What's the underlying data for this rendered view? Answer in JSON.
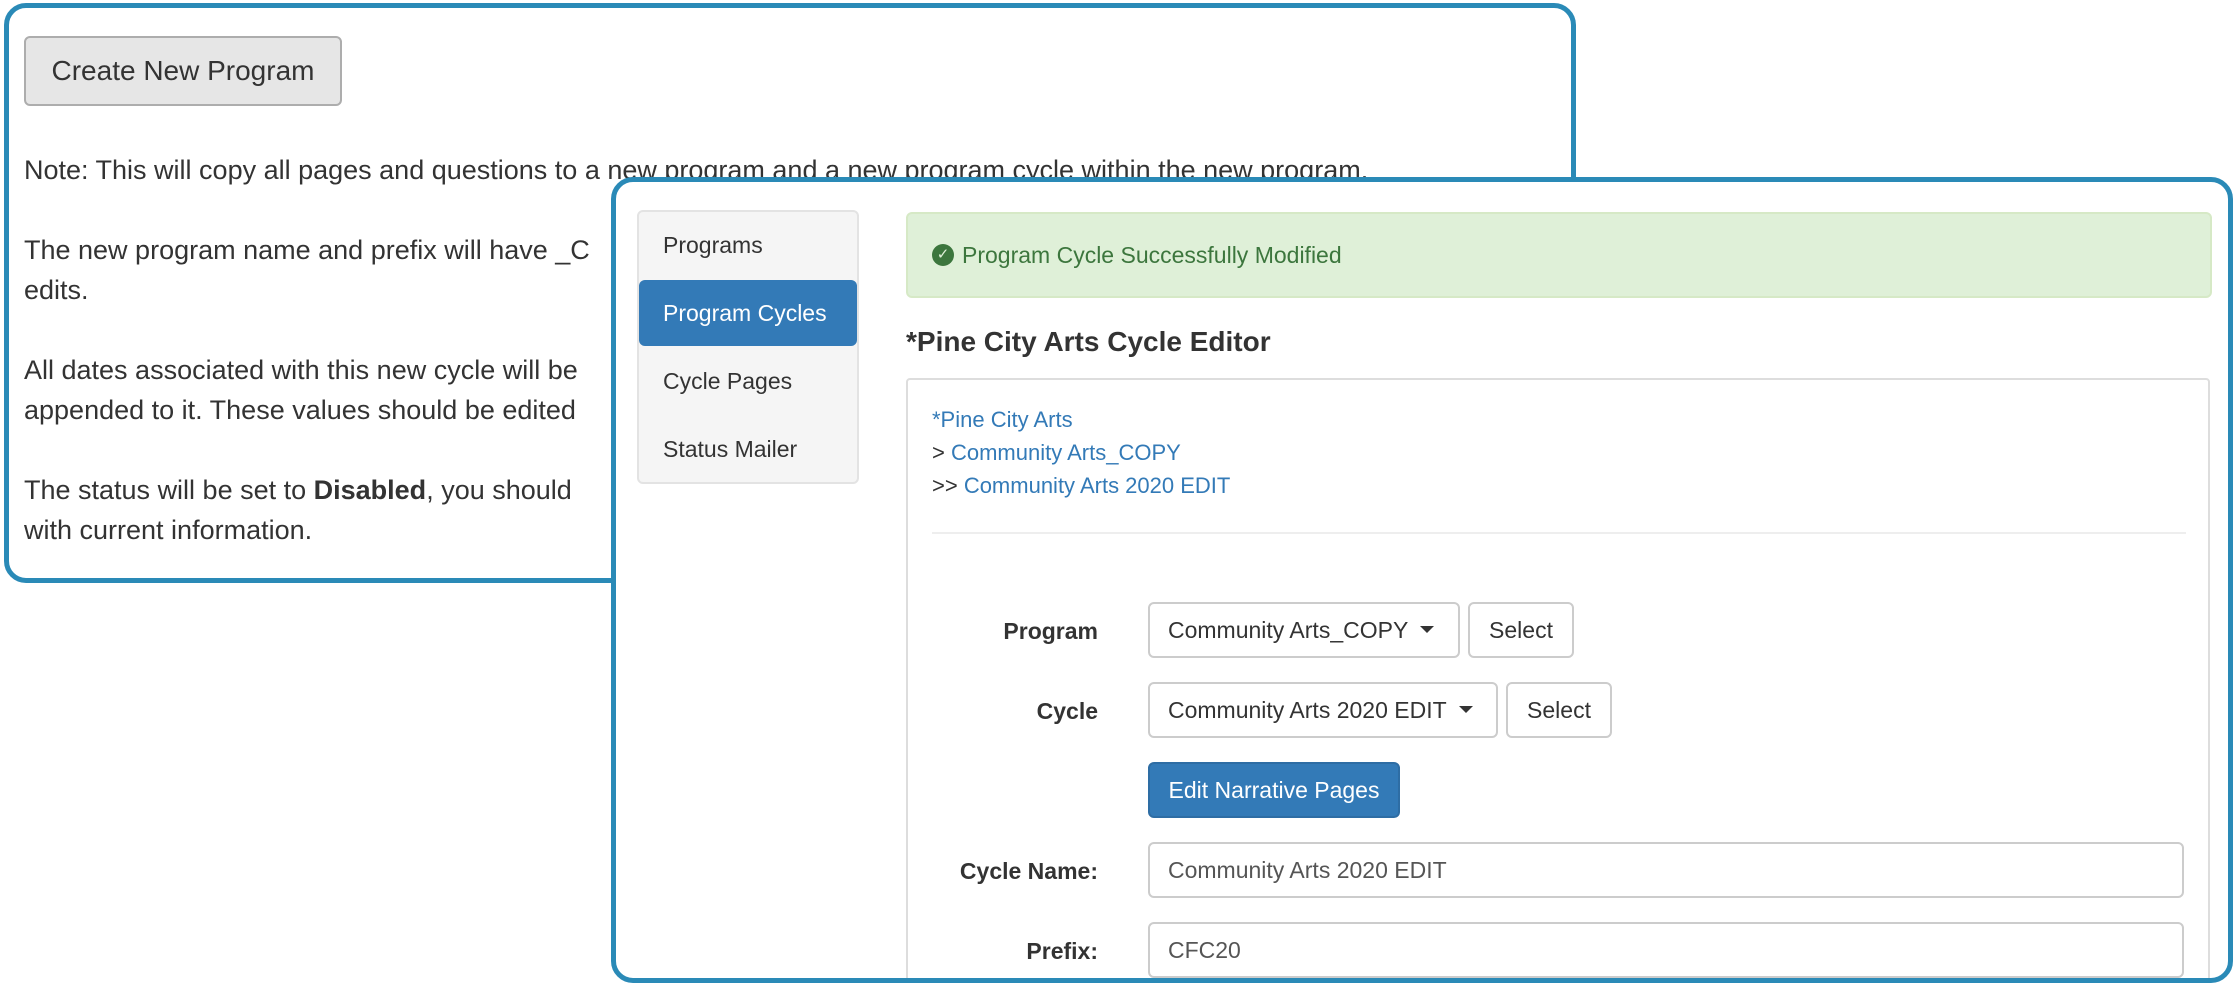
{
  "back_panel": {
    "create_button": "Create New Program",
    "note_lines": [
      "Note: This will copy all pages and questions to a new program and a new program cycle within the new program.",
      "The new program name and prefix will have _C",
      "edits.",
      "All dates associated with this new cycle will be",
      "appended to it. These values should be edited",
      "with current information."
    ],
    "status_line": {
      "before": "The status will be set to ",
      "bold": "Disabled",
      "after": ", you should"
    }
  },
  "sidebar": {
    "items": [
      {
        "label": "Programs",
        "active": false
      },
      {
        "label": "Program Cycles",
        "active": true
      },
      {
        "label": "Cycle Pages",
        "active": false
      },
      {
        "label": "Status Mailer",
        "active": false
      }
    ]
  },
  "alert": {
    "icon": "check-circle-icon",
    "message": "Program Cycle Successfully Modified"
  },
  "editor": {
    "title": "*Pine City Arts Cycle Editor",
    "breadcrumbs": [
      {
        "prefix": "",
        "label": "*Pine City Arts"
      },
      {
        "prefix": "> ",
        "label": "Community Arts_COPY"
      },
      {
        "prefix": ">> ",
        "label": "Community Arts 2020 EDIT"
      }
    ]
  },
  "form": {
    "program_label": "Program",
    "program_value": "Community Arts_COPY",
    "cycle_label": "Cycle",
    "cycle_value": "Community Arts 2020 EDIT",
    "select_label": "Select",
    "edit_narrative_label": "Edit Narrative Pages",
    "cycle_name_label": "Cycle Name:",
    "cycle_name_value": "Community Arts 2020 EDIT",
    "prefix_label": "Prefix:",
    "prefix_value": "CFC20"
  },
  "colors": {
    "accent_border": "#2a8ab7",
    "primary": "#337ab7",
    "success_bg": "#dff0d8",
    "success_text": "#3c763d"
  }
}
